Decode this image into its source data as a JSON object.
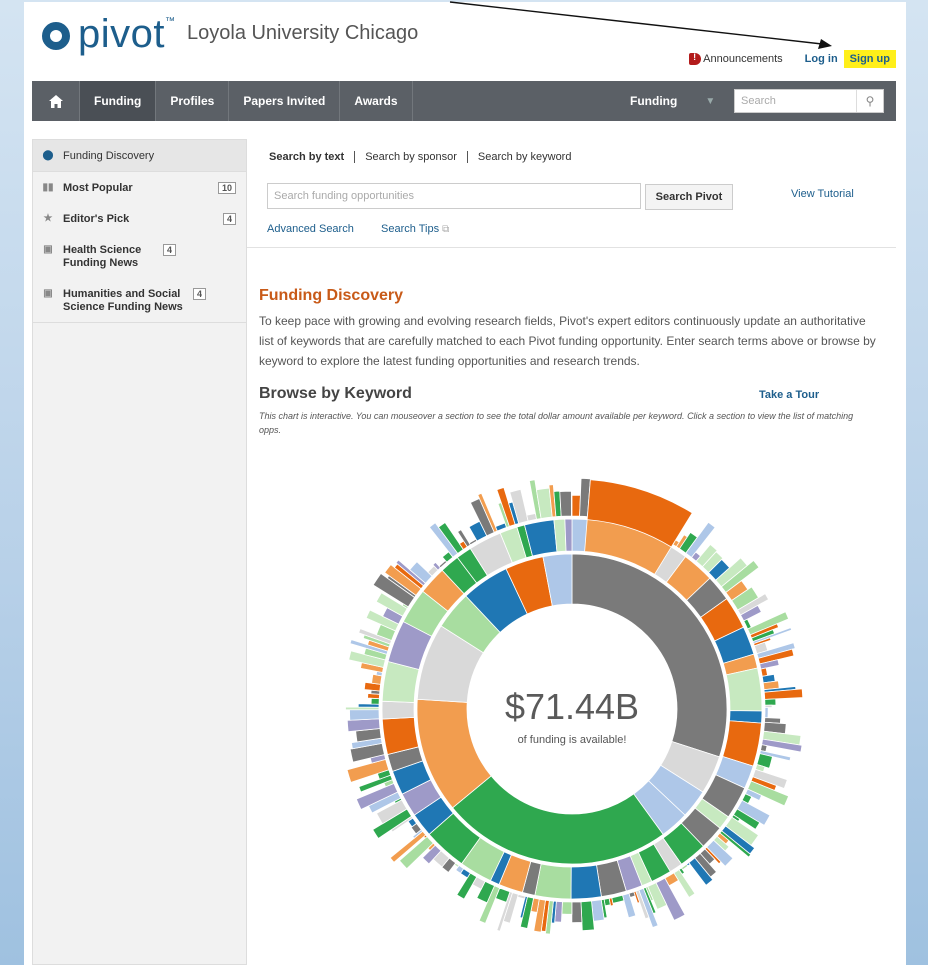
{
  "header": {
    "logo_text": "pivot",
    "logo_tm": "™",
    "institution": "Loyola University Chicago",
    "announcements": "Announcements",
    "login": "Log in",
    "signup": "Sign up"
  },
  "nav": {
    "home_icon": "home-icon",
    "items": [
      "Funding",
      "Profiles",
      "Papers Invited",
      "Awards"
    ],
    "select_value": "Funding",
    "search_placeholder": "Search"
  },
  "sidebar": {
    "items": [
      {
        "label": "Funding Discovery",
        "icon": "pivot-logo-icon",
        "badge": ""
      },
      {
        "label": "Most Popular",
        "icon": "bar-chart-icon",
        "badge": "10"
      },
      {
        "label": "Editor's Pick",
        "icon": "award-icon",
        "badge": "4"
      },
      {
        "label": "Health Science Funding News",
        "icon": "news-icon",
        "badge": "4"
      },
      {
        "label": "Humanities and Social Science Funding News",
        "icon": "news-icon",
        "badge": "4"
      }
    ]
  },
  "search": {
    "tabs": [
      "Search by text",
      "Search by sponsor",
      "Search by keyword"
    ],
    "placeholder": "Search funding opportunities",
    "button": "Search Pivot",
    "tutorial": "View Tutorial",
    "advanced": "Advanced Search",
    "tips": "Search Tips"
  },
  "content": {
    "title": "Funding Discovery",
    "body": "To keep pace with growing and evolving research fields, Pivot's expert editors continuously update an authoritative list of keywords that are carefully matched to each Pivot funding opportunity. Enter search terms above or browse by keyword to explore the latest funding opportunities and research trends.",
    "browse_title": "Browse by Keyword",
    "tour": "Take a Tour",
    "note": "This chart is interactive. You can mouseover a section to see the total dollar amount available per keyword. Click a section to view the list of matching opps."
  },
  "chart_data": {
    "type": "sunburst",
    "center_value": "$71.44B",
    "center_label": "of funding is available!",
    "colors": [
      "#f29d4f",
      "#e8690f",
      "#7a7a7a",
      "#2fa84f",
      "#1f77b4",
      "#aec7e8",
      "#a8dda0",
      "#d9d9d9",
      "#9e9ac8",
      "#c7e9c0"
    ]
  }
}
